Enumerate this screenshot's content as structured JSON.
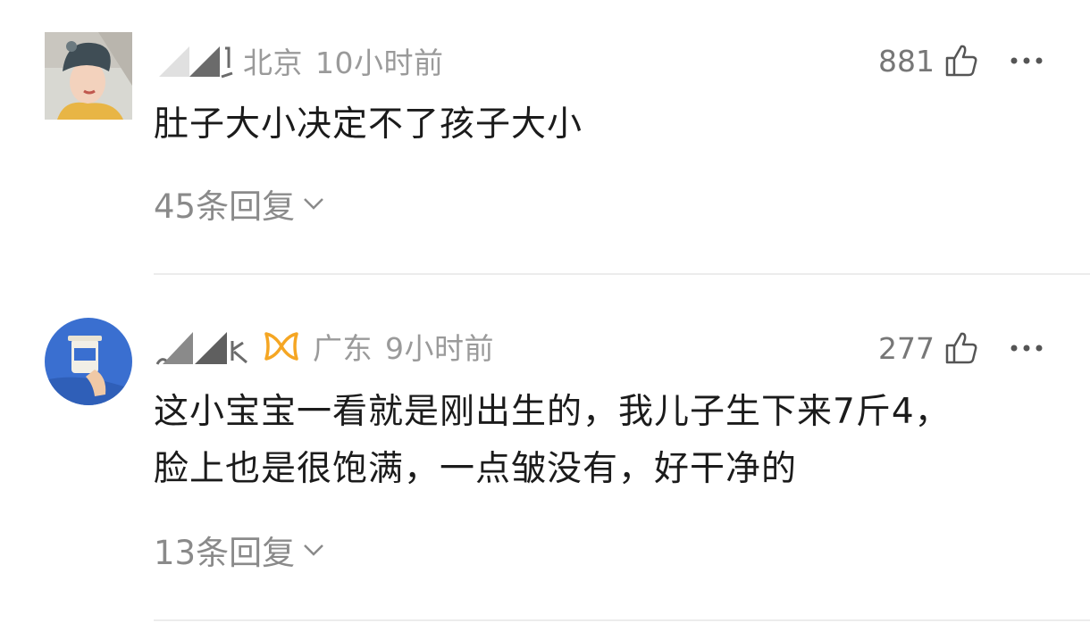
{
  "comments": [
    {
      "location": "北京",
      "time": "10小时前",
      "likes": "881",
      "content_lines": [
        "肚子大小决定不了孩子大小"
      ],
      "replies": "45条回复",
      "avatar_icon": "user-photo-winter-hat",
      "badge_icon": null
    },
    {
      "location": "广东",
      "time": "9小时前",
      "likes": "277",
      "content_lines": [
        "这小宝宝一看就是刚出生的，我儿子生下来7斤4，",
        "脸上也是很饱满，一点皱没有，好干净的"
      ],
      "replies": "13条回复",
      "avatar_icon": "user-photo-coffee-cup",
      "badge_icon": "orange-badge-icon"
    }
  ],
  "colors": {
    "meta_gray": "#9a9a9a",
    "text": "#1b1b1b",
    "badge_orange": "#f5a623",
    "divider": "#ececec"
  }
}
